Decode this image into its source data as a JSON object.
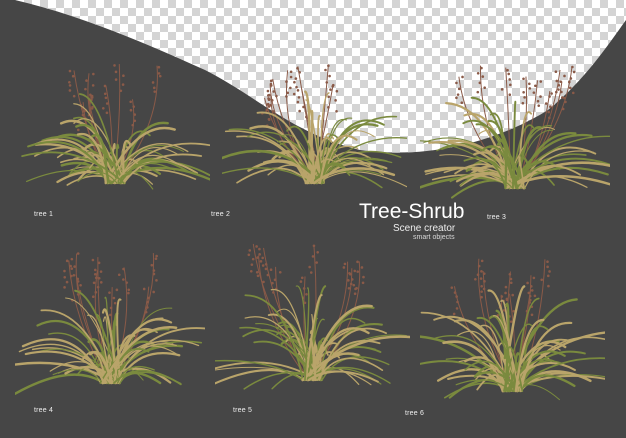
{
  "title": "Tree-Shrub",
  "subtitle": "Scene creator",
  "note": "smart objects",
  "labels": [
    "tree 1",
    "tree 2",
    "tree 3",
    "tree 4",
    "tree 5",
    "tree 6"
  ],
  "colors": {
    "background": "#464646",
    "transparency_light": "#ffffff",
    "transparency_dark": "#d4d4d4",
    "leaf_green": "#7a8a3e",
    "leaf_dry": "#b9a46a",
    "flower_stem": "#8a5a48",
    "text": "#ffffff"
  }
}
